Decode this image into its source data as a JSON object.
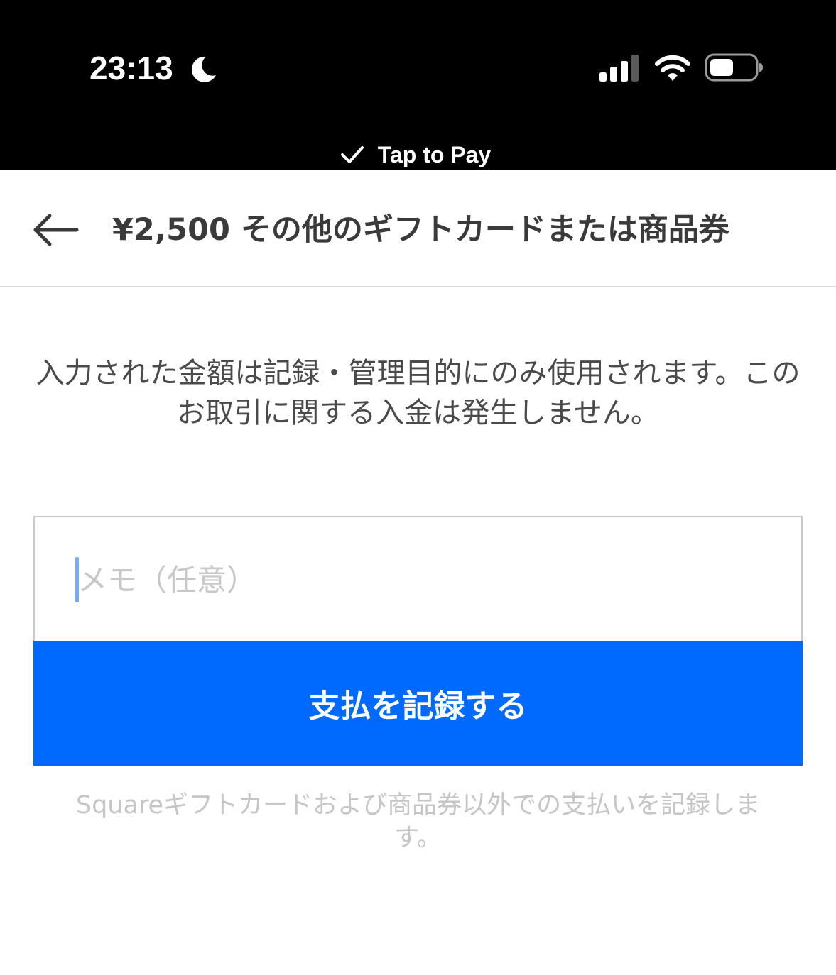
{
  "status_bar": {
    "time": "23:13",
    "icons": [
      "moon-icon",
      "signal-icon",
      "wifi-icon",
      "battery-icon"
    ]
  },
  "banner": {
    "label": "Tap to Pay",
    "icon": "check-icon"
  },
  "header": {
    "back_icon": "back-arrow-icon",
    "title": "¥2,500 その他のギフトカードまたは商品券"
  },
  "main": {
    "info_text": "入力された金額は記録・管理目的にのみ使用されます。このお取引に関する入金は発生しません。",
    "memo": {
      "placeholder": "メモ（任意）",
      "value": ""
    },
    "record_button_label": "支払を記録する",
    "footnote": "Squareギフトカードおよび商品券以外での支払いを記録します。"
  },
  "colors": {
    "accent": "#006aff",
    "status_bar_bg": "#000000",
    "title_text": "#3a3a3a",
    "body_text": "#4a4a4a",
    "muted_text": "#c6c6c6"
  }
}
